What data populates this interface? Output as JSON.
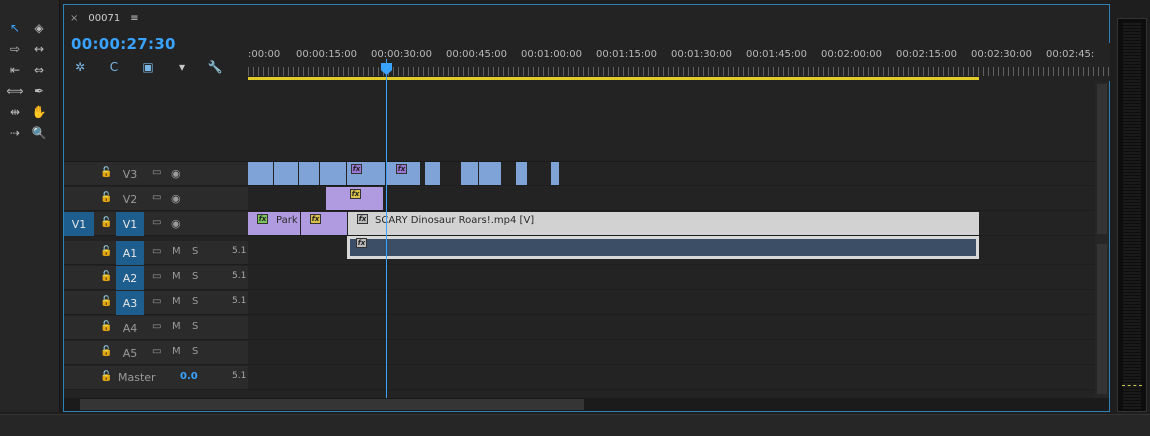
{
  "tab": {
    "close": "×",
    "title": "00071",
    "menu": "≡"
  },
  "timecode": "00:00:27:30",
  "ruler": {
    "labels": [
      ":00:00",
      "00:00:15:00",
      "00:00:30:00",
      "00:00:45:00",
      "00:01:00:00",
      "00:01:15:00",
      "00:01:30:00",
      "00:01:45:00",
      "00:02:00:00",
      "00:02:15:00",
      "00:02:30:00",
      "00:02:45:"
    ]
  },
  "tracks": {
    "v3": {
      "name": "V3"
    },
    "v2": {
      "name": "V2"
    },
    "v1": {
      "source": "V1",
      "name": "V1"
    },
    "a1": {
      "name": "A1",
      "m": "M",
      "s": "S",
      "ch": "5.1"
    },
    "a2": {
      "name": "A2",
      "m": "M",
      "s": "S",
      "ch": "5.1"
    },
    "a3": {
      "name": "A3",
      "m": "M",
      "s": "S",
      "ch": "5.1"
    },
    "a4": {
      "name": "A4",
      "m": "M",
      "s": "S"
    },
    "a5": {
      "name": "A5",
      "m": "M",
      "s": "S"
    },
    "master": {
      "name": "Master",
      "vol": "0.0",
      "ch": "5.1"
    }
  },
  "clips": {
    "fx": "fx",
    "v1_park": "Park",
    "v1_main": "SCARY Dinosaur Roars!.mp4 [V]"
  },
  "icons": {
    "lock": "🔓",
    "sync": "▭",
    "eye": "◉"
  },
  "colors": {
    "accent": "#3aa3ff",
    "v3_clip": "#7fa3d6",
    "v2_clip": "#b09ae0",
    "work_area": "#e2cc2a"
  }
}
